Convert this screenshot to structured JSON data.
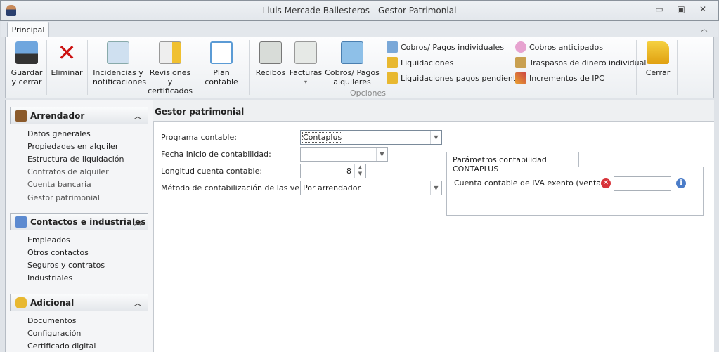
{
  "window": {
    "title": "Lluis Mercade Ballesteros - Gestor Patrimonial",
    "minimize": "▭",
    "restore": "▣",
    "close": "✕",
    "collapse": "︿"
  },
  "ribbon": {
    "tab": "Principal",
    "group_label": "Opciones",
    "large": [
      {
        "l1": "Guardar",
        "l2": "y cerrar"
      },
      {
        "l1": "Eliminar",
        "l2": ""
      },
      {
        "l1": "Incidencias y",
        "l2": "notificaciones"
      },
      {
        "l1": "Revisiones y",
        "l2": "certificados"
      },
      {
        "l1": "Plan contable",
        "l2": ""
      },
      {
        "l1": "Recibos",
        "l2": ""
      },
      {
        "l1": "Facturas",
        "l2": "▾"
      },
      {
        "l1": "Cobros/ Pagos",
        "l2": "alquileres"
      }
    ],
    "small": [
      "Cobros/ Pagos individuales",
      "Liquidaciones",
      "Liquidaciones pagos pendientes",
      "Cobros anticipados",
      "Traspasos de dinero individual",
      "Incrementos de IPC"
    ],
    "close": "Cerrar"
  },
  "sidebar": {
    "sections": [
      {
        "title": "Arrendador",
        "items": [
          "Datos generales",
          "Propiedades en alquiler",
          "Estructura de liquidación",
          "Contratos de alquiler",
          "Cuenta bancaria",
          "Gestor patrimonial"
        ]
      },
      {
        "title": "Contactos e industriales",
        "items": [
          "Empleados",
          "Otros contactos",
          "Seguros y contratos",
          "Industriales"
        ]
      },
      {
        "title": "Adicional",
        "items": [
          "Documentos",
          "Configuración",
          "Certificado digital"
        ]
      }
    ]
  },
  "main": {
    "title": "Gestor patrimonial",
    "fields": {
      "programa_label": "Programa contable:",
      "programa_value": "Contaplus",
      "fecha_label": "Fecha inicio de contabilidad:",
      "fecha_value": "",
      "longitud_label": "Longitud cuenta contable:",
      "longitud_value": "8",
      "metodo_label": "Método de contabilización de las ventas:",
      "metodo_value": "Por arrendador"
    },
    "panel": {
      "tab": "Parámetros contabilidad CONTAPLUS",
      "cuenta_label": "Cuenta contable de IVA exento (ventas)",
      "cuenta_value": "",
      "error_icon": "✕",
      "info_icon": "i"
    }
  }
}
